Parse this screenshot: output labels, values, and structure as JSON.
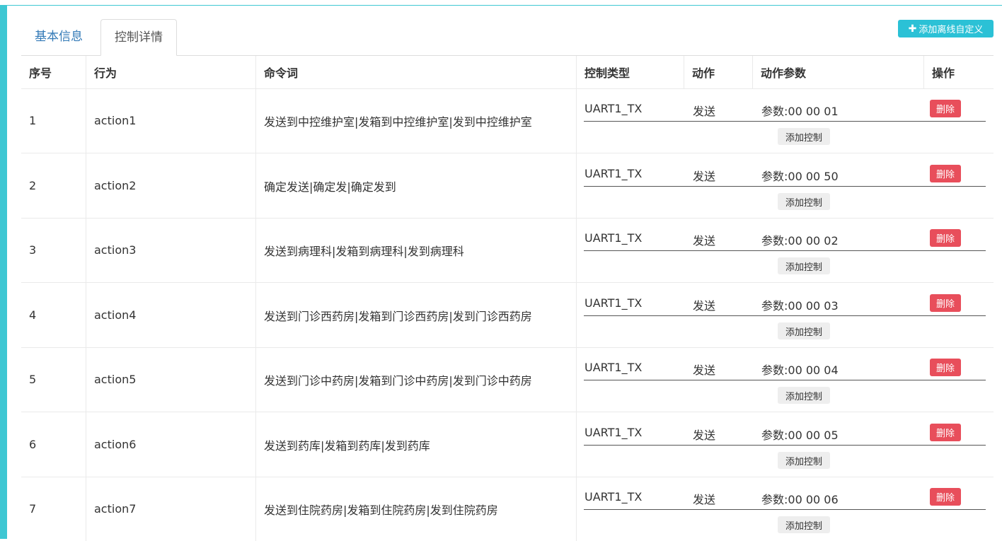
{
  "tabs": {
    "basic": "基本信息",
    "control": "控制详情"
  },
  "toolbar": {
    "add_offline_label": "添加离线自定义",
    "add_icon": "plus-icon"
  },
  "table": {
    "headers": {
      "index": "序号",
      "behavior": "行为",
      "command": "命令词",
      "control_type": "控制类型",
      "action": "动作",
      "params": "动作参数",
      "operation": "操作"
    },
    "delete_label": "删除",
    "add_control_label": "添加控制",
    "rows": [
      {
        "index": "1",
        "behavior": "action1",
        "command": "发送到中控维护室|发箱到中控维护室|发到中控维护室",
        "control_type": "UART1_TX",
        "action": "发送",
        "params": "参数:00 00 01"
      },
      {
        "index": "2",
        "behavior": "action2",
        "command": "确定发送|确定发|确定发到",
        "control_type": "UART1_TX",
        "action": "发送",
        "params": "参数:00 00 50"
      },
      {
        "index": "3",
        "behavior": "action3",
        "command": "发送到病理科|发箱到病理科|发到病理科",
        "control_type": "UART1_TX",
        "action": "发送",
        "params": "参数:00 00 02"
      },
      {
        "index": "4",
        "behavior": "action4",
        "command": "发送到门诊西药房|发箱到门诊西药房|发到门诊西药房",
        "control_type": "UART1_TX",
        "action": "发送",
        "params": "参数:00 00 03"
      },
      {
        "index": "5",
        "behavior": "action5",
        "command": "发送到门诊中药房|发箱到门诊中药房|发到门诊中药房",
        "control_type": "UART1_TX",
        "action": "发送",
        "params": "参数:00 00 04"
      },
      {
        "index": "6",
        "behavior": "action6",
        "command": "发送到药库|发箱到药库|发到药库",
        "control_type": "UART1_TX",
        "action": "发送",
        "params": "参数:00 00 05"
      },
      {
        "index": "7",
        "behavior": "action7",
        "command": "发送到住院药房|发箱到住院药房|发到住院药房",
        "control_type": "UART1_TX",
        "action": "发送",
        "params": "参数:00 00 06"
      }
    ]
  },
  "colors": {
    "accent": "#3ec7d3",
    "add_button": "#2bc1d6",
    "delete_button": "#e84e5b",
    "tab_link": "#337ab7"
  }
}
